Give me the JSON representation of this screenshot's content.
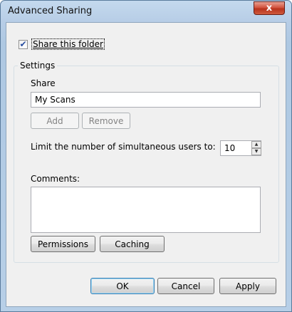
{
  "window": {
    "title": "Advanced Sharing",
    "close_glyph": "x"
  },
  "share_folder": {
    "label": "Share this folder",
    "checked": true,
    "check_glyph": "✔"
  },
  "settings": {
    "group_title": "Settings",
    "share_label": "Share",
    "share_name": "My Scans",
    "add_button": "Add",
    "remove_button": "Remove",
    "limit_label": "Limit the number of simultaneous users to:",
    "limit_value": "10",
    "comments_label": "Comments:",
    "comments_value": "",
    "permissions_button": "Permissions",
    "caching_button": "Caching"
  },
  "footer": {
    "ok_button": "OK",
    "cancel_button": "Cancel",
    "apply_button": "Apply"
  },
  "spinner": {
    "up_glyph": "▲",
    "down_glyph": "▼"
  }
}
